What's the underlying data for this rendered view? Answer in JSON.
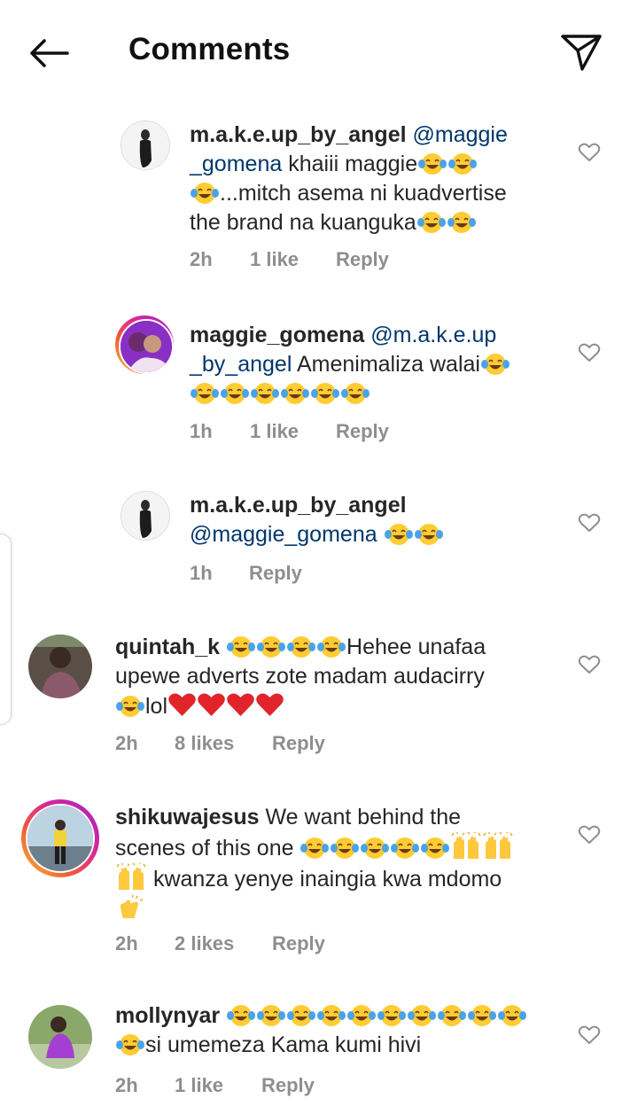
{
  "header": {
    "title": "Comments",
    "back_icon": "arrow-left-icon",
    "send_icon": "paper-plane-icon"
  },
  "colors": {
    "text": "#262626",
    "muted": "#8e8e8e",
    "mention": "#00376b",
    "heart_emoji": "#e0242a"
  },
  "comments": [
    {
      "username": "m.a.k.e.up_by_angel",
      "text_lines": [
        {
          "parts": [
            {
              "t": "@maggie",
              "m": true
            }
          ]
        },
        {
          "parts": [
            {
              "t": "_gomena",
              "m": true
            },
            {
              "t": " khaiii maggie"
            },
            {
              "e": "joy"
            },
            {
              "e": "joy"
            }
          ]
        },
        {
          "parts": [
            {
              "e": "joy"
            },
            {
              "t": "...mitch asema ni kuadvertise"
            }
          ]
        },
        {
          "parts": [
            {
              "t": "the brand na kuanguka"
            },
            {
              "e": "joy"
            },
            {
              "e": "joy"
            }
          ]
        }
      ],
      "time": "2h",
      "likes": "1 like",
      "reply": "Reply"
    },
    {
      "username": "maggie_gomena",
      "text_lines": [
        {
          "parts": [
            {
              "t": "@m.a.k.e.up",
              "m": true
            }
          ]
        },
        {
          "parts": [
            {
              "t": "_by_angel",
              "m": true
            },
            {
              "t": " Amenimaliza walai"
            },
            {
              "e": "joy"
            }
          ]
        },
        {
          "parts": [
            {
              "e": "joy"
            },
            {
              "e": "joy"
            },
            {
              "e": "joy"
            },
            {
              "e": "joy"
            },
            {
              "e": "joy"
            },
            {
              "e": "joy"
            }
          ]
        }
      ],
      "time": "1h",
      "likes": "1 like",
      "reply": "Reply"
    },
    {
      "username": "m.a.k.e.up_by_angel",
      "text_lines": [
        {
          "parts": []
        },
        {
          "parts": [
            {
              "t": "@maggie_gomena",
              "m": true
            },
            {
              "t": " "
            },
            {
              "e": "joy"
            },
            {
              "e": "joy"
            }
          ]
        }
      ],
      "time": "1h",
      "likes": "",
      "reply": "Reply"
    },
    {
      "username": "quintah_k",
      "text_lines": [
        {
          "parts": [
            {
              "t": " "
            },
            {
              "e": "joy"
            },
            {
              "e": "joy"
            },
            {
              "e": "joy"
            },
            {
              "e": "joy"
            },
            {
              "t": "Hehee unafaa"
            }
          ]
        },
        {
          "parts": [
            {
              "t": "upewe adverts zote madam audacirry"
            }
          ]
        },
        {
          "parts": [
            {
              "e": "joy"
            },
            {
              "t": "lol"
            },
            {
              "e": "heart"
            },
            {
              "e": "heart"
            },
            {
              "e": "heart"
            },
            {
              "e": "heart"
            }
          ]
        }
      ],
      "time": "2h",
      "likes": "8 likes",
      "reply": "Reply"
    },
    {
      "username": "shikuwajesus",
      "text_lines": [
        {
          "parts": [
            {
              "t": " We want behind the"
            }
          ]
        },
        {
          "parts": [
            {
              "t": "scenes of this one "
            },
            {
              "e": "joy"
            },
            {
              "e": "joy"
            },
            {
              "e": "joy"
            },
            {
              "e": "joy"
            },
            {
              "e": "joy"
            },
            {
              "e": "hands"
            },
            {
              "e": "hands"
            }
          ]
        },
        {
          "parts": [
            {
              "e": "hands"
            },
            {
              "t": " kwanza yenye inaingia kwa mdomo"
            }
          ]
        },
        {
          "parts": [
            {
              "e": "clap"
            }
          ]
        }
      ],
      "time": "2h",
      "likes": "2 likes",
      "reply": "Reply"
    },
    {
      "username": "mollynyar",
      "text_lines": [
        {
          "parts": [
            {
              "t": " "
            },
            {
              "e": "joy"
            },
            {
              "e": "joy"
            },
            {
              "e": "joy"
            },
            {
              "e": "joy"
            },
            {
              "e": "joy"
            },
            {
              "e": "joy"
            },
            {
              "e": "joy"
            },
            {
              "e": "joy"
            },
            {
              "e": "joy"
            },
            {
              "e": "joy"
            }
          ]
        },
        {
          "parts": [
            {
              "e": "joy"
            },
            {
              "t": "si umemeza Kama kumi hivi"
            }
          ]
        }
      ],
      "time": "2h",
      "likes": "1 like",
      "reply": "Reply"
    }
  ]
}
